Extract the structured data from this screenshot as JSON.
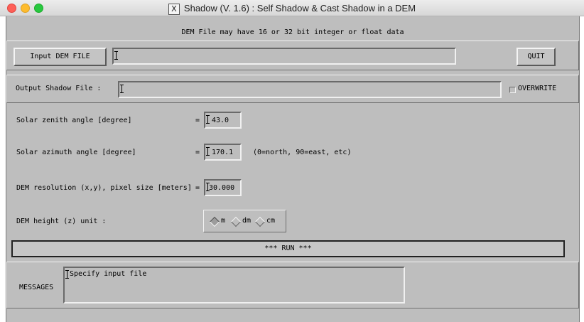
{
  "window": {
    "title": "Shadow (V. 1.6) : Self Shadow & Cast Shadow in a DEM",
    "title_icon_glyph": "X",
    "colors": {
      "background": "#bebebe",
      "close": "#fe5f57",
      "minimize": "#febc2e",
      "zoom": "#28c840"
    }
  },
  "notice": "DEM File may have 16 or 32 bit integer or float data",
  "input_row": {
    "button_label": "Input DEM FILE",
    "value": "",
    "quit_label": "QUIT"
  },
  "output_row": {
    "label": "Output Shadow File  :",
    "value": "",
    "overwrite_label": "OVERWRITE",
    "overwrite_checked": false
  },
  "parameters": {
    "zenith": {
      "label": "Solar zenith angle [degree]",
      "equals": "=",
      "value": "43.0"
    },
    "azimuth": {
      "label": "Solar azimuth angle [degree]",
      "equals": "=",
      "value": "170.1",
      "hint": "(0=north, 90=east, etc)"
    },
    "resolution": {
      "label": "DEM resolution (x,y), pixel size [meters]",
      "equals": "=",
      "value": "30.000"
    },
    "height_unit": {
      "label": "DEM height (z) unit :",
      "options": [
        "m",
        "dm",
        "cm"
      ],
      "selected": "m"
    }
  },
  "run_label": "*** RUN ***",
  "messages": {
    "label": "MESSAGES",
    "text": "Specify input file"
  }
}
